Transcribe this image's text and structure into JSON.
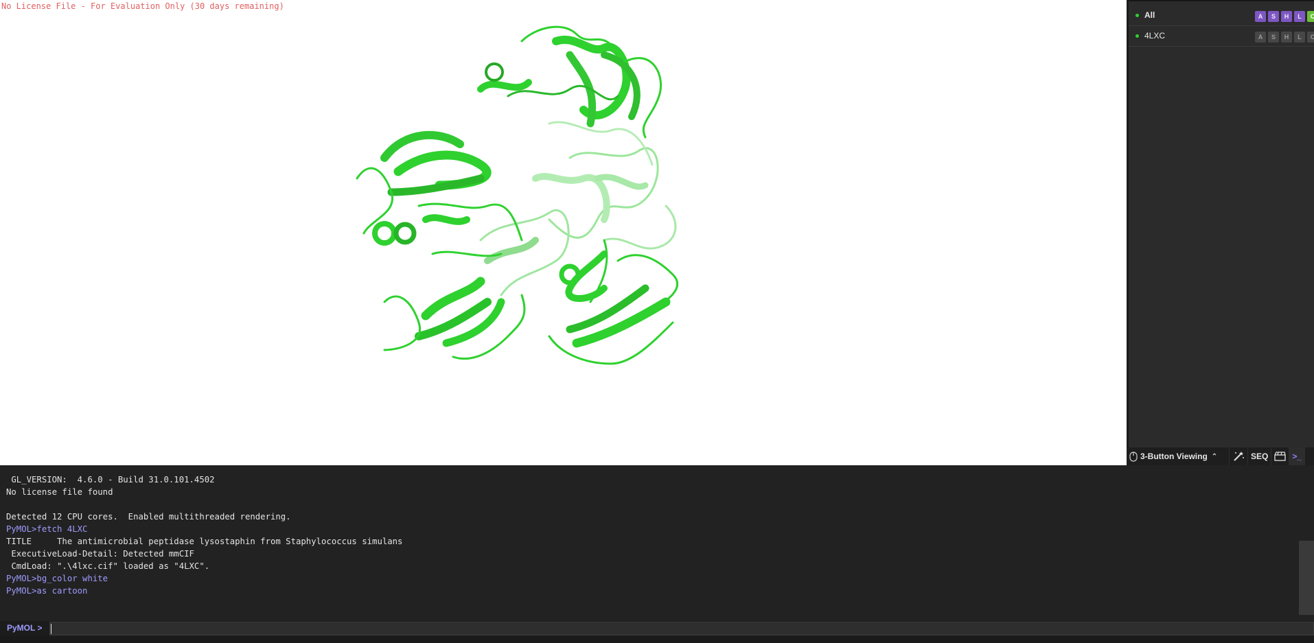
{
  "viewport": {
    "license_notice": "No License File - For Evaluation Only (30 days remaining)",
    "background_color": "#ffffff",
    "cartoon_color": "#2ed12e"
  },
  "object_panel": {
    "objects": [
      {
        "name": "All",
        "bold": true,
        "buttons": [
          "A",
          "S",
          "H",
          "L",
          "C"
        ],
        "enabled": true
      },
      {
        "name": "4LXC",
        "bold": false,
        "buttons": [
          "A",
          "S",
          "H",
          "L",
          "C"
        ],
        "enabled": true
      }
    ],
    "toolbar": {
      "mouse_mode": "3-Button Viewing",
      "seq": "SEQ"
    }
  },
  "console": {
    "lines": [
      {
        "text": " GL_VERSION:  4.6.0 - Build 31.0.101.4502",
        "type": "output"
      },
      {
        "text": "No license file found",
        "type": "output"
      },
      {
        "text": "",
        "type": "output"
      },
      {
        "text": "Detected 12 CPU cores.  Enabled multithreaded rendering.",
        "type": "output"
      },
      {
        "text": "PyMOL>fetch 4LXC",
        "type": "command"
      },
      {
        "text": "TITLE     The antimicrobial peptidase lysostaphin from Staphylococcus simulans",
        "type": "output"
      },
      {
        "text": " ExecutiveLoad-Detail: Detected mmCIF",
        "type": "output"
      },
      {
        "text": " CmdLoad: \".\\4lxc.cif\" loaded as \"4LXC\".",
        "type": "output"
      },
      {
        "text": "PyMOL>bg_color white",
        "type": "command"
      },
      {
        "text": "PyMOL>as cartoon",
        "type": "command"
      }
    ],
    "prompt": "PyMOL >",
    "input_value": ""
  }
}
